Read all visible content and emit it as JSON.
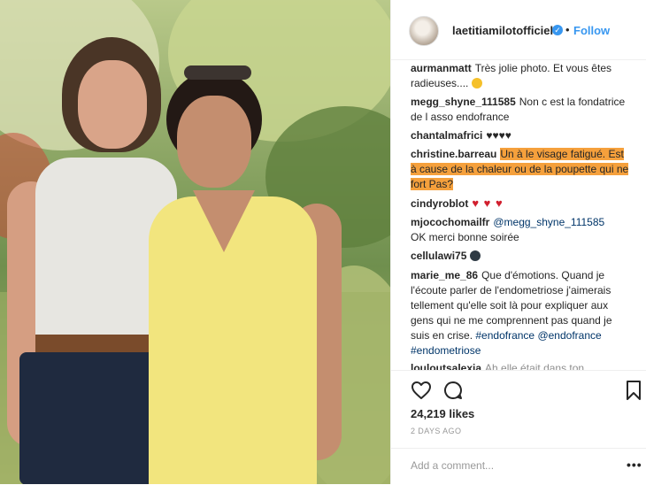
{
  "header": {
    "username": "laetitiamilotofficiel",
    "separator": "•",
    "follow_label": "Follow"
  },
  "comments": [
    {
      "user": "aurmanmatt",
      "text": "Très jolie photo. Et vous êtes radieuses....",
      "emoji": "smiling-face-emoji"
    },
    {
      "user": "megg_shyne_111585",
      "text": "Non c est la fondatrice de l asso endofrance"
    },
    {
      "user": "chantalmafrici",
      "text": "♥♥♥♥"
    },
    {
      "user": "christine.barreau",
      "text": "Un à le visage fatigué. Est à cause de la chaleur ou de la poupette qui ne fort Pas?"
    },
    {
      "user": "cindyroblot",
      "text": "♥ ♥ ♥"
    },
    {
      "user": "mjocochomailfr",
      "mention": "@megg_shyne_111585",
      "text": "OK merci bonne soirée"
    },
    {
      "user": "cellulawi75",
      "emoji": "ufo-emoji"
    },
    {
      "user": "marie_me_86",
      "text": "Que d'émotions. Quand je l'écoute parler de l'endometriose j'aimerais tellement qu'elle soit là pour expliquer aux gens qui ne me comprennent pas quand je suis en crise.",
      "tags": [
        "#endofrance",
        "@endofrance",
        "#endometriose"
      ]
    },
    {
      "user": "louloutsalexia",
      "text": "Ah elle était dans ton"
    }
  ],
  "stats": {
    "likes": "24,219 likes",
    "time": "2 DAYS AGO"
  },
  "add_comment": {
    "placeholder": "Add a comment...",
    "more_label": "•••"
  },
  "icons": [
    "heart-icon",
    "comment-icon",
    "bookmark-icon",
    "verified-badge-icon"
  ],
  "colors": {
    "accent": "#3897f0",
    "highlight": "#f5a03c",
    "text": "#262626",
    "muted": "#999999"
  }
}
